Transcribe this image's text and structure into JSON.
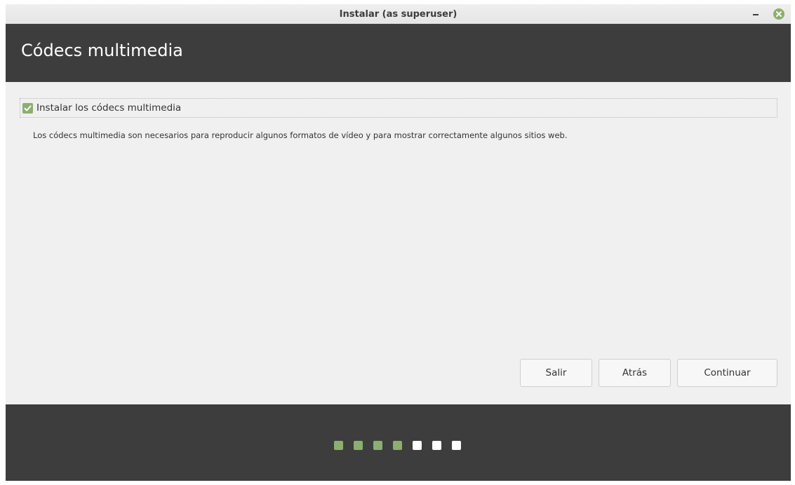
{
  "window": {
    "title": "Instalar (as superuser)"
  },
  "header": {
    "title": "Códecs multimedia"
  },
  "option": {
    "label": "Instalar los códecs multimedia",
    "checked": true,
    "description": "Los códecs multimedia son necesarios para reproducir algunos formatos de vídeo y para mostrar correctamente algunos sitios web."
  },
  "buttons": {
    "quit": "Salir",
    "back": "Atrás",
    "continue": "Continuar"
  },
  "progress": {
    "steps_total": 7,
    "steps_completed": 4,
    "completed_color": "#8ab06e",
    "pending_color": "#ffffff"
  },
  "colors": {
    "accent": "#8ab06e",
    "header_bg": "#3d3d3d",
    "close_button": "#8ab06e"
  },
  "icons": {
    "minimize": "minimize-icon",
    "close": "close-icon",
    "check": "checkmark-icon"
  }
}
